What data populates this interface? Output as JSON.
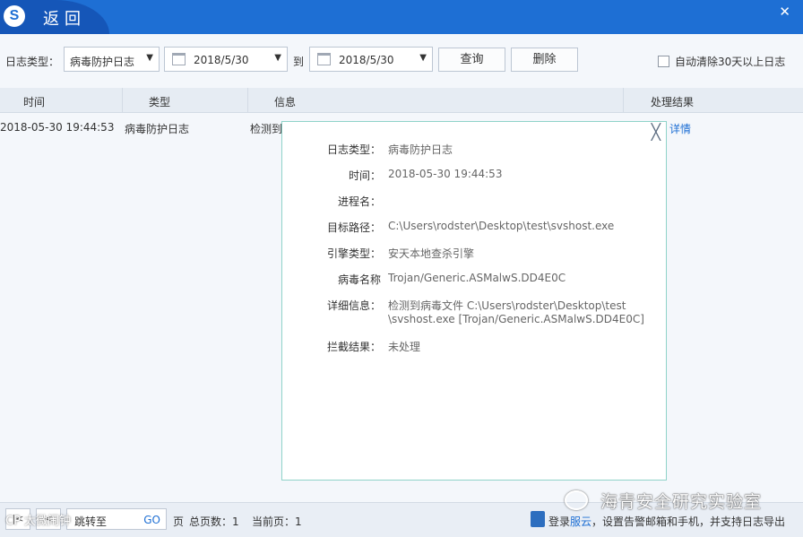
{
  "titlebar": {
    "back_label": "返回",
    "logo_glyph": "S",
    "close_glyph": "✕"
  },
  "toolbar": {
    "log_type_label": "日志类型：",
    "log_type_value": "病毒防护日志",
    "date_from": "2018/5/30",
    "to_label": "到",
    "date_to": "2018/5/30",
    "query_label": "查询",
    "delete_label": "删除",
    "auto_clear_label": "自动清除30天以上日志",
    "auto_clear_checked": false
  },
  "table": {
    "columns": [
      "时间",
      "类型",
      "信息",
      "处理结果"
    ],
    "rows": [
      {
        "time": "2018-05-30 19:44:53",
        "type": "病毒防护日志",
        "info": "检测到",
        "result": "详情"
      }
    ]
  },
  "popup": {
    "close_glyph": "╳",
    "fields": [
      {
        "key": "日志类型：",
        "value": "病毒防护日志"
      },
      {
        "key": "时间：",
        "value": "2018-05-30 19:44:53"
      },
      {
        "key": "进程名：",
        "value": ""
      },
      {
        "key": "目标路径：",
        "value": "C:\\Users\\rodster\\Desktop\\test\\svshost.exe"
      },
      {
        "key": "引擎类型：",
        "value": "安天本地查杀引擎"
      },
      {
        "key": "病毒名称",
        "value": "Trojan/Generic.ASMalwS.DD4E0C"
      },
      {
        "key": "详细信息：",
        "value": "检测到病毒文件 C:\\Users\\rodster\\Desktop\\test",
        "value2": "\\svshost.exe [Trojan/Generic.ASMalwS.DD4E0C]"
      },
      {
        "key": "拦截结果：",
        "value": "未处理"
      }
    ]
  },
  "footer": {
    "first_glyph": "|<",
    "prev_glyph": "<",
    "jump_placeholder": "跳转至",
    "go_label": "GO",
    "page_unit": "页",
    "total_pages_label": "总页数：1",
    "current_page_label": "当前页：1",
    "cloud_login": "登录",
    "cloud_name": "服云",
    "cloud_text": "，设置告警邮箱和手机，并支持日志导出"
  },
  "watermark": {
    "text": "海青安全研究实验室",
    "left_text": "CP  太微闹钟"
  }
}
